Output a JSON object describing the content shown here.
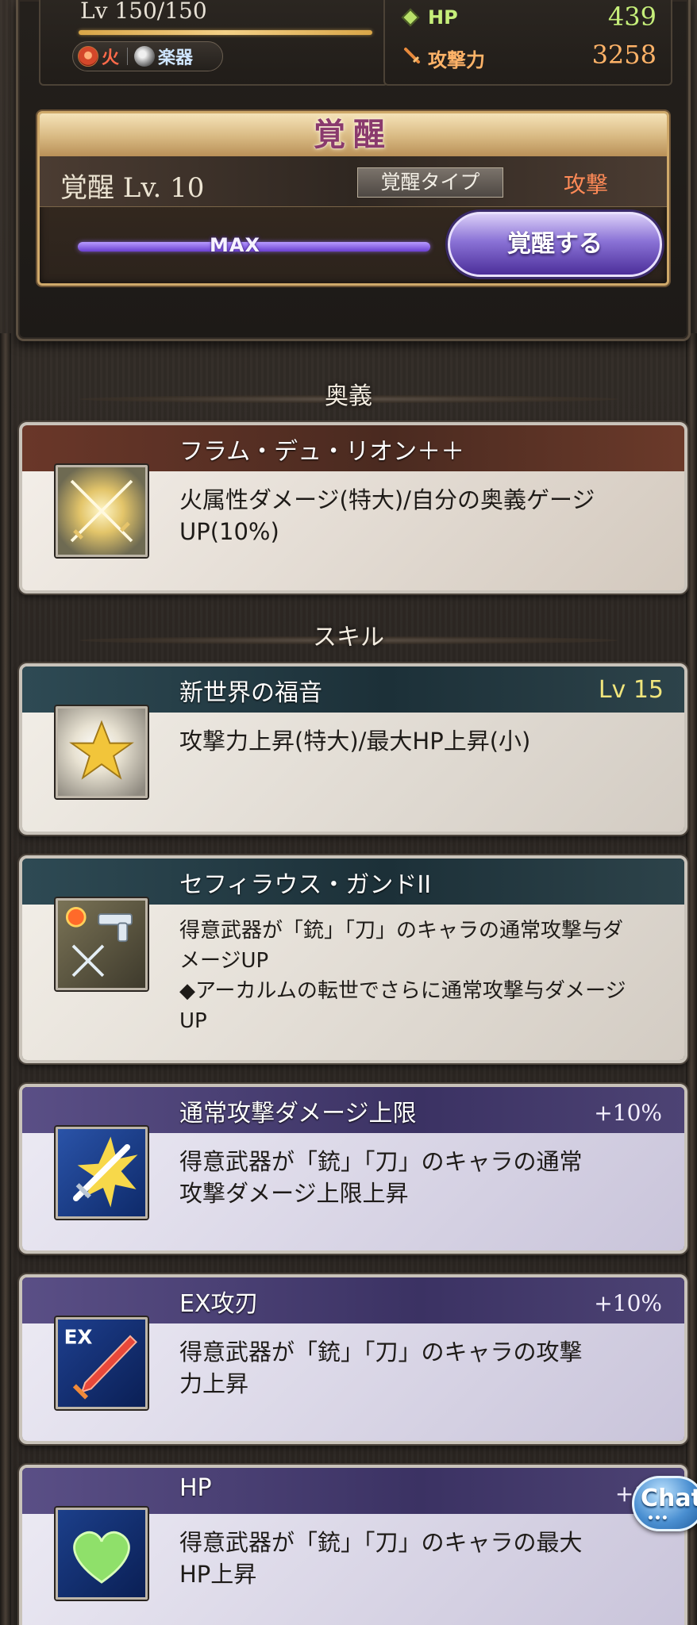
{
  "status": {
    "level": "Lv 150/150",
    "element_label": "火",
    "weapon_label": "楽器",
    "hp_label": "HP",
    "hp_value": "439",
    "atk_label": "攻撃力",
    "atk_value": "3258"
  },
  "awakening": {
    "title": "覚醒",
    "level": "覚醒 Lv. 10",
    "type_label": "覚醒タイプ",
    "type_value": "攻撃",
    "progress_label": "MAX",
    "button_label": "覚醒する"
  },
  "sections": {
    "ougi_title": "奥義",
    "skill_title": "スキル"
  },
  "ougi": {
    "name": "フラム・デュ・リオン＋＋",
    "desc_line1": "火属性ダメージ(特大)/自分の奥義ゲージ",
    "desc_line2": "UP(10%)"
  },
  "skills": [
    {
      "name": "新世界の福音",
      "level": "Lv 15",
      "desc": "攻撃力上昇(特大)/最大HP上昇(小)"
    },
    {
      "name": "セフィラウス・ガンドII",
      "desc_line1": "得意武器が「銃」「刀」のキャラの通常攻撃与ダ",
      "desc_line2": "メージUP",
      "desc_line3": "◆アーカルムの転世でさらに通常攻撃与ダメージ",
      "desc_line4": "UP"
    }
  ],
  "plus_bonuses": [
    {
      "name": "通常攻撃ダメージ上限",
      "bonus": "+10%",
      "desc_line1": "得意武器が「銃」「刀」のキャラの通常",
      "desc_line2": "攻撃ダメージ上限上昇"
    },
    {
      "name": "EX攻刃",
      "bonus": "+10%",
      "icon_text": "EX",
      "desc_line1": "得意武器が「銃」「刀」のキャラの攻撃",
      "desc_line2": "力上昇"
    },
    {
      "name": "HP",
      "bonus": "+10",
      "desc_line1": "得意武器が「銃」「刀」のキャラの最大",
      "desc_line2": "HP上昇"
    }
  ],
  "chat": {
    "label": "Chat",
    "dots": "•••"
  },
  "colors": {
    "hp": "#c6ef7a",
    "attack": "#ffb368",
    "fire": "#ff6a4a",
    "awaken_type": "#ff8a57",
    "skill_level": "#f0e57c",
    "max_bar": "#6a3fd0"
  }
}
